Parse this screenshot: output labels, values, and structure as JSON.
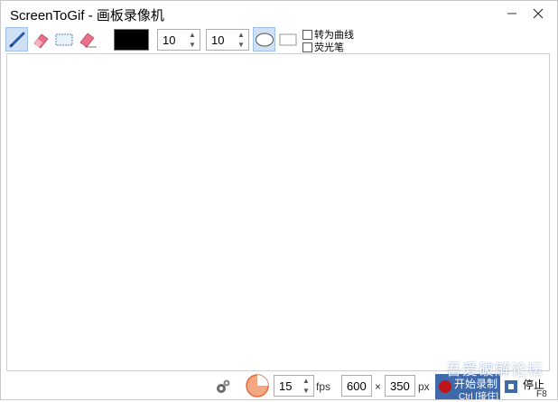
{
  "window": {
    "title": "ScreenToGif - 画板录像机"
  },
  "titlebar": {
    "minimize_icon": "minimize-icon",
    "close_icon": "close-icon"
  },
  "toolbar": {
    "tools": [
      {
        "name": "pen-tool",
        "icon": "pencil-icon",
        "selected": true
      },
      {
        "name": "eraser-tool",
        "icon": "eraser-icon",
        "selected": false
      },
      {
        "name": "select-tool",
        "icon": "rectangle-select-icon",
        "selected": false
      },
      {
        "name": "stroke-eraser-tool",
        "icon": "stroke-eraser-icon",
        "selected": false
      }
    ],
    "color": "#000000",
    "width_value": "10",
    "height_value": "10",
    "checkboxes": [
      {
        "label": "转为曲线",
        "checked": false
      },
      {
        "label": "荧光笔",
        "checked": false
      }
    ]
  },
  "statusbar": {
    "fps_value": "15",
    "fps_label": "fps",
    "width_value": "600",
    "times": "×",
    "height_value": "350",
    "px_label": "px",
    "record_label": "开始录制",
    "record_shortcut": "Ctrl [接住]",
    "stop_label": "停止",
    "stop_shortcut": "F8"
  },
  "watermark": "吾爱破解论坛"
}
